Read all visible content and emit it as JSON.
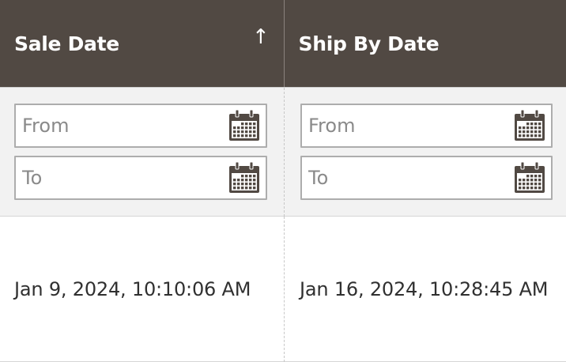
{
  "columns": [
    {
      "label": "Sale Date",
      "sort_icon": "arrow-up-icon",
      "sort_glyph": "↑"
    },
    {
      "label": "Ship By Date"
    }
  ],
  "filters": {
    "from_placeholder": "From",
    "to_placeholder": "To",
    "icon": "calendar-icon"
  },
  "rows": [
    {
      "sale_date": "Jan 9, 2024, 10:10:06 AM",
      "ship_by_date": "Jan 16, 2024, 10:28:45 AM"
    }
  ],
  "colors": {
    "header_bg": "#514943",
    "header_text": "#ffffff",
    "filter_bg": "#f2f2f2",
    "input_border": "#adadad",
    "icon": "#514943",
    "text": "#303030"
  }
}
